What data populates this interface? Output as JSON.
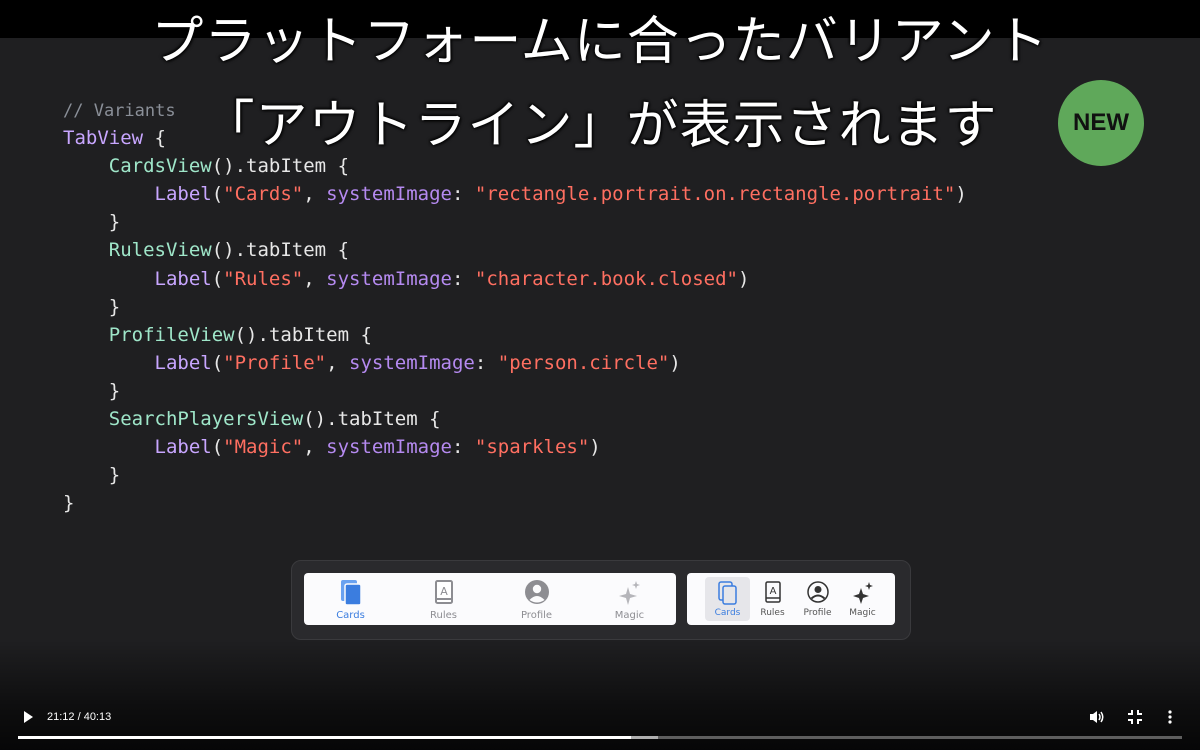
{
  "subtitles": {
    "line1": "プラットフォームに合ったバリアント",
    "line2": "「アウトライン」が表示されます"
  },
  "badge": {
    "label": "NEW",
    "color": "#5fa85a"
  },
  "code": {
    "comment": "// Variants",
    "tabview": "TabView",
    "items": [
      {
        "view": "CardsView",
        "label": "\"Cards\"",
        "image": "\"rectangle.portrait.on.rectangle.portrait\""
      },
      {
        "view": "RulesView",
        "label": "\"Rules\"",
        "image": "\"character.book.closed\""
      },
      {
        "view": "ProfileView",
        "label": "\"Profile\"",
        "image": "\"person.circle\""
      },
      {
        "view": "SearchPlayersView",
        "label": "\"Magic\"",
        "image": "\"sparkles\""
      }
    ],
    "tokens": {
      "tab_item": ".tabItem",
      "label_call": "Label",
      "system_image": "systemImage"
    }
  },
  "tab_bars": {
    "large": [
      {
        "label": "Cards",
        "icon": "cards-icon",
        "selected": true
      },
      {
        "label": "Rules",
        "icon": "book-icon",
        "selected": false
      },
      {
        "label": "Profile",
        "icon": "person-circle-icon",
        "selected": false
      },
      {
        "label": "Magic",
        "icon": "sparkles-icon",
        "selected": false
      }
    ],
    "small": [
      {
        "label": "Cards",
        "icon": "cards-outline-icon",
        "selected": true
      },
      {
        "label": "Rules",
        "icon": "book-outline-icon",
        "selected": false
      },
      {
        "label": "Profile",
        "icon": "person-circle-outline-icon",
        "selected": false
      },
      {
        "label": "Magic",
        "icon": "sparkles-outline-icon",
        "selected": false
      }
    ],
    "accent": "#3b7ddf"
  },
  "player": {
    "time": "21:12 / 40:13",
    "played_fraction": 0.527,
    "loaded_fraction": 0.55
  }
}
